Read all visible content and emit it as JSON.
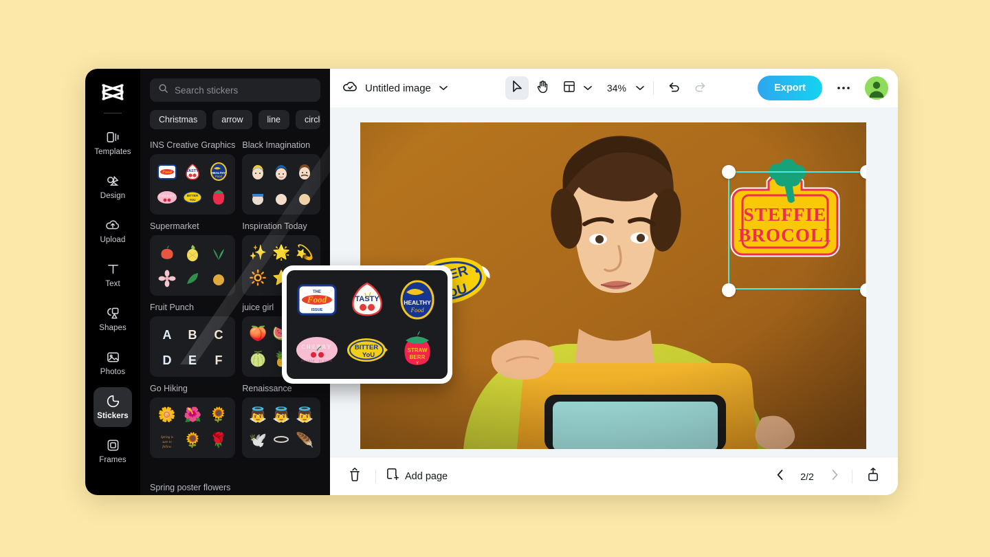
{
  "app": {
    "background_color": "#FCE8A8",
    "logo_name": "capcut-logo"
  },
  "sidebar": {
    "items": [
      {
        "label": "Templates",
        "icon": "templates-icon",
        "active": false
      },
      {
        "label": "Design",
        "icon": "design-icon",
        "active": false
      },
      {
        "label": "Upload",
        "icon": "upload-icon",
        "active": false
      },
      {
        "label": "Text",
        "icon": "text-icon",
        "active": false
      },
      {
        "label": "Shapes",
        "icon": "shapes-icon",
        "active": false
      },
      {
        "label": "Photos",
        "icon": "photos-icon",
        "active": false
      },
      {
        "label": "Stickers",
        "icon": "stickers-icon",
        "active": true
      },
      {
        "label": "Frames",
        "icon": "frames-icon",
        "active": false
      }
    ]
  },
  "sticker_panel": {
    "search": {
      "placeholder": "Search stickers",
      "value": "",
      "icon": "search-icon"
    },
    "tags": [
      "Christmas",
      "arrow",
      "line",
      "circle"
    ],
    "packs": [
      {
        "title": "INS Creative Graphics"
      },
      {
        "title": "Black Imagination"
      },
      {
        "title": "Supermarket"
      },
      {
        "title": "Inspiration Today"
      },
      {
        "title": "Fruit Punch"
      },
      {
        "title": "Go Hiking"
      },
      {
        "title": "juice girl"
      },
      {
        "title": "Spring poster flowers"
      },
      {
        "title": "Renaissance"
      }
    ]
  },
  "magnifier": {
    "stickers": [
      {
        "name": "the-food-issue",
        "lines": [
          "THE",
          "Food",
          "ISSUE"
        ]
      },
      {
        "name": "tasty-cherries",
        "lines": [
          "TASTY"
        ]
      },
      {
        "name": "healthy-food-banana",
        "lines": [
          "HEALTHY",
          "Food"
        ]
      },
      {
        "name": "cherry-oval",
        "lines": [
          "CHERRY",
          "01 DATE · 01 DATE"
        ]
      },
      {
        "name": "bitter-you-lemon",
        "lines": [
          "BITTER",
          "YoU"
        ]
      },
      {
        "name": "strawberry",
        "lines": [
          "STRAW",
          "BERR",
          "Y"
        ]
      }
    ]
  },
  "toolbar": {
    "save_status_icon": "cloud-check-icon",
    "document_title": "Untitled image",
    "title_caret": "chevron-down-icon",
    "select_tool": "cursor-icon",
    "hand_tool": "hand-icon",
    "layout_tool": "layout-icon",
    "zoom_level": "34%",
    "undo": "undo-icon",
    "redo": "redo-icon",
    "export_label": "Export",
    "more_label": "more-options",
    "avatar_label": "user-avatar",
    "accent_color": "#15C7F0"
  },
  "canvas": {
    "background_color": "#A9691A",
    "selection_color": "#4EE8E0",
    "stickers": [
      {
        "name": "bitter-you-lemon",
        "lines": [
          "BITTER",
          "YoU"
        ],
        "selected": false
      },
      {
        "name": "steffie-brocoli",
        "lines": [
          "STEFFIE",
          "BROCOLI"
        ],
        "selected": true
      }
    ]
  },
  "bottombar": {
    "delete_icon": "delete-page-icon",
    "add_page_label": "Add page",
    "add_page_icon": "add-page-icon",
    "prev_icon": "chevron-left-icon",
    "page_indicator": "2/2",
    "next_icon": "chevron-right-icon",
    "expand_icon": "expand-pages-icon"
  }
}
